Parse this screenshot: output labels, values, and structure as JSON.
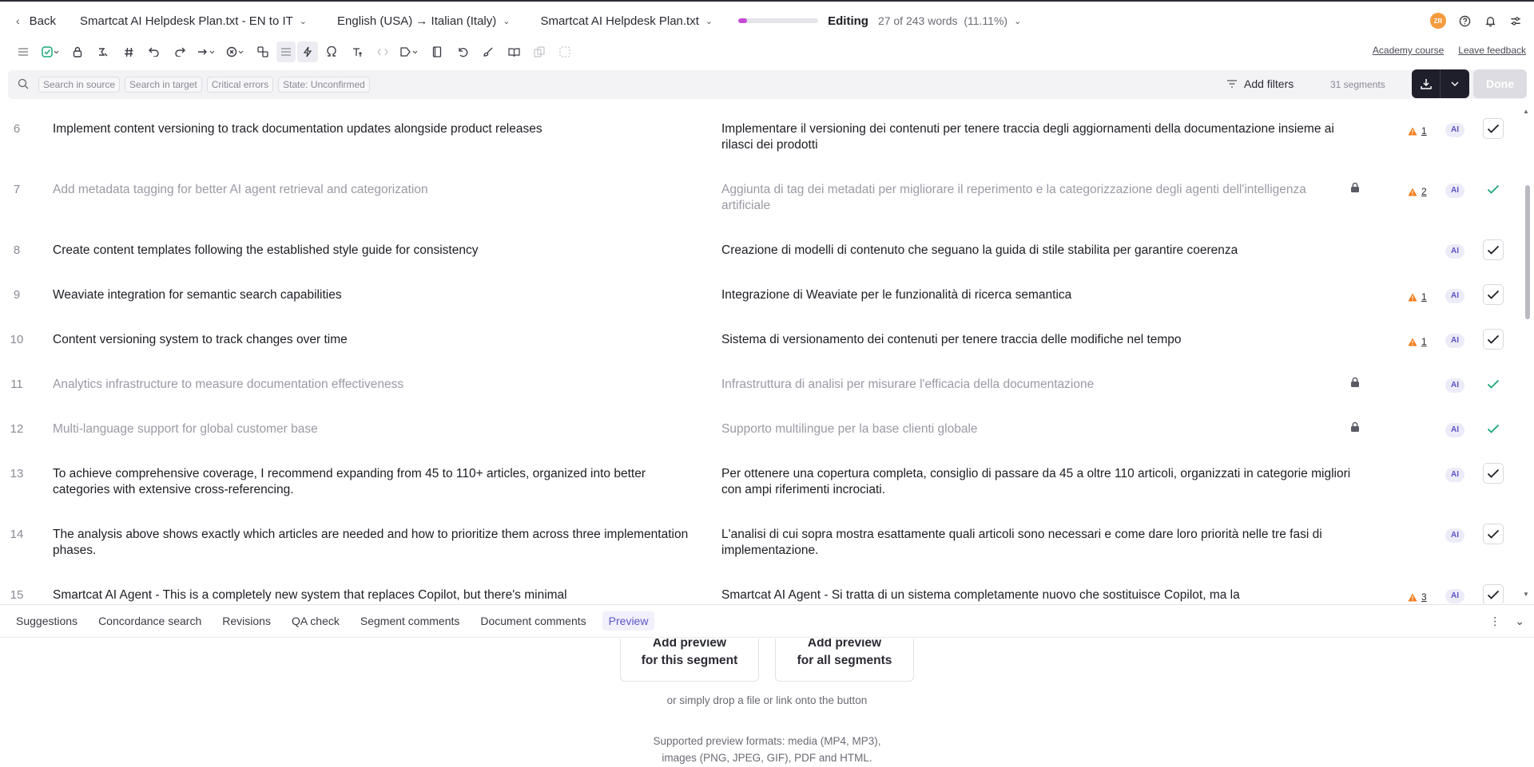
{
  "header": {
    "back_label": "Back",
    "project_title": "Smartcat AI Helpdesk Plan.txt - EN to IT",
    "language_pair": "English (USA) → Italian (Italy)",
    "document_name": "Smartcat AI Helpdesk Plan.txt",
    "progress_fraction": 0.1111,
    "progress_color": "#c64bd6",
    "mode_label": "Editing",
    "word_progress": "27 of 243 words",
    "word_percent": "(11.11%)",
    "avatar_initials": "ZR",
    "avatar_color": "#f59b3d"
  },
  "toolbar": {
    "academy_link": "Academy course",
    "feedback_link": "Leave feedback"
  },
  "filters": {
    "chips": [
      "Search in source",
      "Search in target",
      "Critical errors",
      "State: Unconfirmed"
    ],
    "add_filters_label": "Add filters",
    "segment_count": "31 segments",
    "done_label": "Done"
  },
  "segments": [
    {
      "num": "6",
      "source": "Implement content versioning to track documentation updates alongside product releases",
      "target": "Implementare il versioning dei contenuti per tenere traccia degli aggiornamenti della documentazione insieme ai rilasci dei prodotti",
      "confirmed": false,
      "locked": false,
      "warnings": "1",
      "ai": "AI"
    },
    {
      "num": "7",
      "source": "Add metadata tagging for better AI agent retrieval and categorization",
      "target": "Aggiunta di tag dei metadati per migliorare il reperimento e la categorizzazione degli agenti dell'intelligenza artificiale",
      "confirmed": true,
      "locked": true,
      "warnings": "2",
      "ai": "AI"
    },
    {
      "num": "8",
      "source": "Create content templates following the established style guide for consistency",
      "target": "Creazione di modelli di contenuto che seguano la guida di stile stabilita per garantire coerenza",
      "confirmed": false,
      "locked": false,
      "warnings": "",
      "ai": "AI"
    },
    {
      "num": "9",
      "source": "Weaviate integration for semantic search capabilities",
      "target": "Integrazione di Weaviate per le funzionalità di ricerca semantica",
      "confirmed": false,
      "locked": false,
      "warnings": "1",
      "ai": "AI"
    },
    {
      "num": "10",
      "source": "Content versioning system to track changes over time",
      "target": "Sistema di versionamento dei contenuti per tenere traccia delle modifiche nel tempo",
      "confirmed": false,
      "locked": false,
      "warnings": "1",
      "ai": "AI"
    },
    {
      "num": "11",
      "source": "Analytics infrastructure to measure documentation effectiveness",
      "target": "Infrastruttura di analisi per misurare l'efficacia della documentazione",
      "confirmed": true,
      "locked": true,
      "warnings": "",
      "ai": "AI"
    },
    {
      "num": "12",
      "source": "Multi-language support for global customer base",
      "target": "Supporto multilingue per la base clienti globale",
      "confirmed": true,
      "locked": true,
      "warnings": "",
      "ai": "AI"
    },
    {
      "num": "13",
      "source": "To achieve comprehensive coverage, I recommend expanding from 45 to 110+ articles, organized into better categories with extensive cross-referencing.",
      "target": "Per ottenere una copertura completa, consiglio di passare da 45 a oltre 110 articoli, organizzati in categorie migliori con ampi riferimenti incrociati.",
      "confirmed": false,
      "locked": false,
      "warnings": "",
      "ai": "AI"
    },
    {
      "num": "14",
      "source": "The analysis above shows exactly which articles are needed and how to prioritize them across three implementation phases.",
      "target": "L'analisi di cui sopra mostra esattamente quali articoli sono necessari e come dare loro priorità nelle tre fasi di implementazione.",
      "confirmed": false,
      "locked": false,
      "warnings": "",
      "ai": "AI"
    },
    {
      "num": "15",
      "source": "Smartcat AI Agent - This is a completely new system that replaces Copilot, but there's minimal",
      "target": "Smartcat AI Agent - Si tratta di un sistema completamente nuovo che sostituisce Copilot, ma la",
      "confirmed": false,
      "locked": false,
      "warnings": "3",
      "ai": "AI"
    }
  ],
  "bottom_tabs": [
    "Suggestions",
    "Concordance search",
    "Revisions",
    "QA check",
    "Segment comments",
    "Document comments",
    "Preview"
  ],
  "active_tab": "Preview",
  "preview": {
    "button1_line1": "Add preview",
    "button1_line2": "for this segment",
    "button2_line1": "Add preview",
    "button2_line2": "for all segments",
    "drop_note": "or simply drop a file or link onto the button",
    "formats_line1": "Supported preview formats: media (MP4, MP3),",
    "formats_line2": "images (PNG, JPEG, GIF), PDF and HTML."
  },
  "colors": {
    "warning": "#f07b1a",
    "confirmed_check": "#19a974",
    "ai_badge_bg": "#ecebf8",
    "ai_badge_text": "#5c55c2"
  }
}
